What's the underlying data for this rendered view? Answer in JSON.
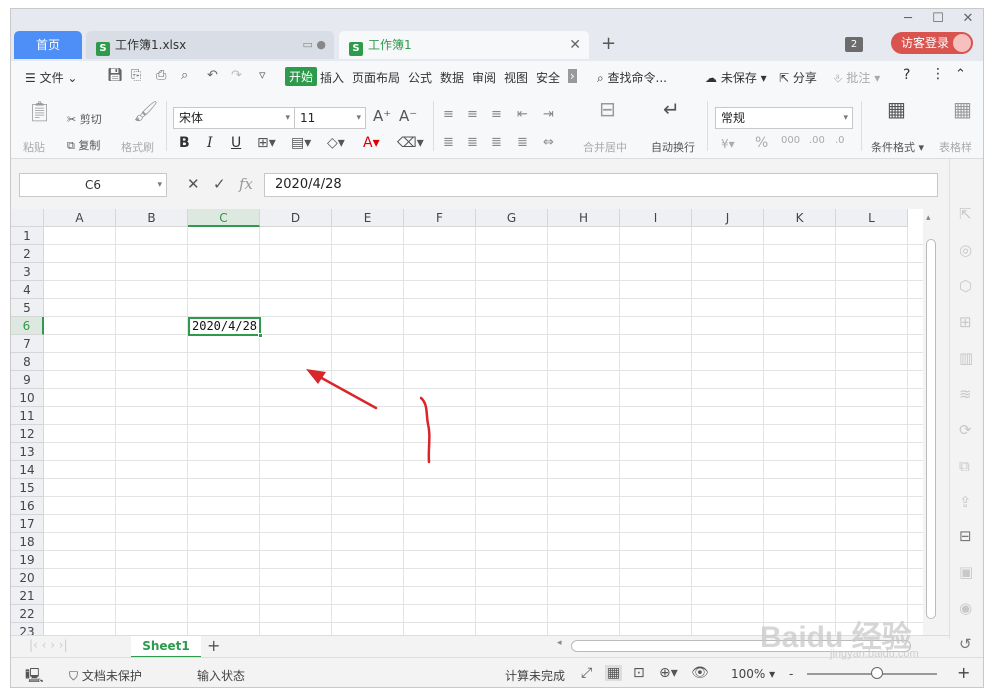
{
  "window_controls": {
    "minimize": "─",
    "maximize": "☐",
    "close": "✕"
  },
  "tabs": {
    "home": "首页",
    "file1": "工作簿1.xlsx",
    "file2": "工作簿1",
    "add": "+"
  },
  "header": {
    "window_count": "2",
    "login": "访客登录"
  },
  "menu": {
    "file": "文件",
    "start": "开始",
    "insert": "插入",
    "page_layout": "页面布局",
    "formula": "公式",
    "data": "数据",
    "review": "审阅",
    "view": "视图",
    "security": "安全",
    "search": "查找命令...",
    "unsaved": "未保存",
    "share": "分享",
    "comment": "批注",
    "help": "?"
  },
  "ribbon": {
    "paste": "粘贴",
    "cut": "剪切",
    "copy": "复制",
    "format_painter": "格式刷",
    "font_name": "宋体",
    "font_size": "11",
    "bold": "B",
    "italic": "I",
    "underline": "U",
    "merge_center": "合并居中",
    "wrap_text": "自动换行",
    "number_format": "常规",
    "percent": "%",
    "cond_format": "条件格式",
    "table_style": "表格样"
  },
  "formula_bar": {
    "name_box": "C6",
    "fx": "fx",
    "value": "2020/4/28"
  },
  "grid": {
    "columns": [
      "A",
      "B",
      "C",
      "D",
      "E",
      "F",
      "G",
      "H",
      "I",
      "J",
      "K",
      "L"
    ],
    "rows": [
      "1",
      "2",
      "3",
      "4",
      "5",
      "6",
      "7",
      "8",
      "9",
      "10",
      "11",
      "12",
      "13",
      "14",
      "15",
      "16",
      "17",
      "18",
      "19",
      "20",
      "21",
      "22",
      "23"
    ],
    "selected_column": "C",
    "selected_row": "6",
    "active_cell_value": "2020/4/28"
  },
  "sheets": {
    "tab": "Sheet1",
    "add": "+"
  },
  "status": {
    "protect": "文档未保护",
    "input_state": "输入状态",
    "calc": "计算未完成",
    "zoom": "100%",
    "zoom_minus": "-",
    "zoom_plus": "+"
  },
  "watermark": {
    "brand": "Baidu 经验",
    "url": "jingyan.baidu.com"
  },
  "colors": {
    "accent_green": "#2e9a4c",
    "home_tab_blue": "#4e8ef7",
    "login_red": "#d9534f",
    "annotation_red": "#d8262a"
  }
}
